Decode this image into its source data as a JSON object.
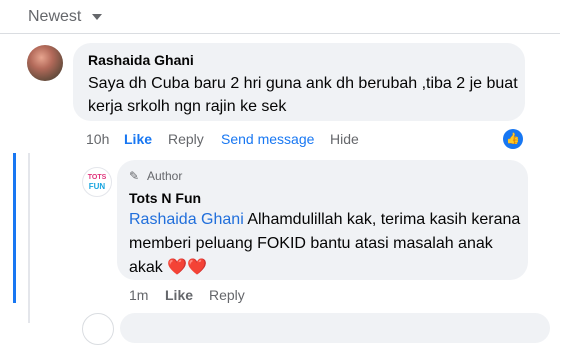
{
  "sort": {
    "label": "Newest"
  },
  "comment": {
    "author": "Rashaida Ghani",
    "text": "Saya dh Cuba baru 2 hri guna ank dh berubah ,tiba 2 je buat kerja srkolh ngn rajin ke sek",
    "time": "10h",
    "like": "Like",
    "reply": "Reply",
    "send_message": "Send message",
    "hide": "Hide",
    "reaction_icon": "like-icon"
  },
  "reply": {
    "badge": "Author",
    "author": "Tots N Fun",
    "avatar_logo_top": "TOTS",
    "avatar_logo_bottom": "FUN",
    "mention": "Rashaida Ghani",
    "text": "Alhamdulillah kak, terima kasih kerana memberi peluang FOKID bantu atasi masalah anak akak",
    "emoji": "❤️❤️",
    "time": "1m",
    "like": "Like",
    "reply": "Reply"
  },
  "colors": {
    "accent": "#1877f2",
    "bubble": "#f0f2f5",
    "muted": "#65676b"
  }
}
